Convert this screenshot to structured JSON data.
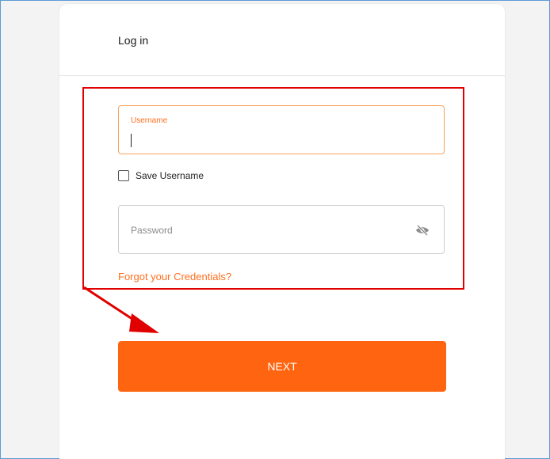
{
  "header": {
    "title": "Log in"
  },
  "username": {
    "label": "Username",
    "value": ""
  },
  "save_username": {
    "label": "Save Username",
    "checked": false
  },
  "password": {
    "placeholder": "Password"
  },
  "forgot_link": "Forgot your Credentials?",
  "next_button": "NEXT",
  "colors": {
    "accent": "#ff6510",
    "link": "#ff6f1f",
    "annotation": "#e00000"
  },
  "icons": {
    "password_visibility": "eye-slash-icon"
  }
}
